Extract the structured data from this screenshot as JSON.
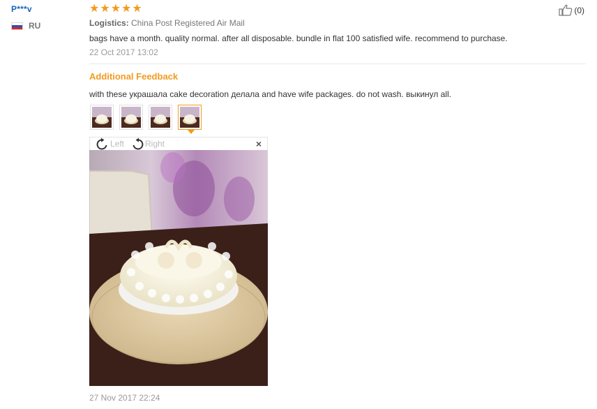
{
  "reviewer": {
    "name": "P***v",
    "country_code": "RU",
    "flag": "russia-flag-icon"
  },
  "review": {
    "stars": 5,
    "star_color": "#f29b1f",
    "logistics_label": "Logistics:",
    "logistics_value": "China Post Registered Air Mail",
    "text": "bags have a month. quality normal. after all disposable. bundle in flat 100 satisfied wife. recommend to purchase.",
    "date": "22 Oct 2017 13:02",
    "helpful_count": "(0)"
  },
  "additional_feedback": {
    "title": "Additional Feedback",
    "text": "with these украшала cake decoration делала and have wife packages. do not wash. выкинул all.",
    "thumbnails": 4,
    "active_thumbnail": 4,
    "date": "27 Nov 2017 22:24"
  },
  "viewer": {
    "rotate_left_label": "Left",
    "rotate_right_label": "Right",
    "close_label": "×"
  }
}
